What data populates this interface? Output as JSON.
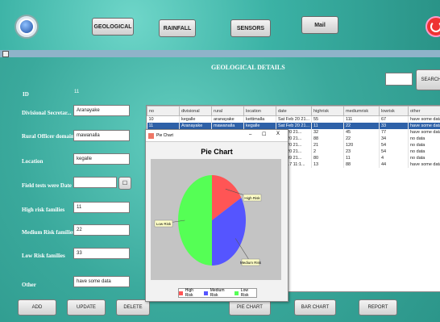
{
  "window": {
    "title": ""
  },
  "toolbar": {
    "geological": "GEOLOGICAL",
    "rainfall": "RAINFALL",
    "sensors": "SENSORS",
    "mail": "Mail"
  },
  "page": {
    "title": "GEOLOGICAL DETAILS"
  },
  "search": {
    "value": "",
    "button": "SEARCH"
  },
  "form": {
    "id_label": "ID",
    "id_value": "11",
    "divisional_label": "Divisional Secretar...",
    "divisional_value": "Aranayake",
    "rural_label": "Rural Officer domain",
    "rural_value": "mawanalla",
    "location_label": "Location",
    "location_value": "kegalle",
    "date_label": "Field tests were Date",
    "date_value": "",
    "high_label": "High risk families",
    "high_value": "11",
    "medium_label": "Medium Risk families",
    "medium_value": "22",
    "low_label": "Low Risk families",
    "low_value": "33",
    "other_label": "Other",
    "other_value": "have some data"
  },
  "table": {
    "columns": [
      "no",
      "divisional",
      "rural",
      "location",
      "date",
      "highrisk",
      "mediumrisk",
      "lowrisk",
      "other"
    ],
    "rows": [
      [
        "10",
        "kegalle",
        "aranayake",
        "kettimalla",
        "Sat Feb 20 21...",
        "55",
        "111",
        "67",
        "have some data"
      ],
      [
        "11",
        "Aranayake",
        "mawanalla",
        "kegalle",
        "Sat Feb 20 21...",
        "11",
        "22",
        "33",
        "have some data"
      ],
      [
        "",
        "",
        "",
        "",
        "Feb 20 21...",
        "32",
        "45",
        "77",
        "have some data"
      ],
      [
        "",
        "",
        "",
        "",
        "Feb 20 21...",
        "88",
        "22",
        "34",
        "no data"
      ],
      [
        "",
        "",
        "",
        "",
        "Feb 20 21...",
        "21",
        "120",
        "54",
        "no data"
      ],
      [
        "",
        "",
        "",
        "",
        "Feb 20 21...",
        "2",
        "23",
        "54",
        "no data"
      ],
      [
        "",
        "",
        "",
        "",
        "Feb 09 21...",
        "80",
        "11",
        "4",
        "no data"
      ],
      [
        "",
        "",
        "",
        "",
        "Feb 17 11:1...",
        "13",
        "88",
        "44",
        "have some data"
      ]
    ],
    "selected_row": 1
  },
  "buttons": {
    "add": "ADD",
    "update": "UPDATE",
    "delete": "DELETE",
    "pie_chart": "PIE CHART",
    "bar_chart": "BAR CHART",
    "report": "REPORT"
  },
  "dialog": {
    "title": "Pie Chart",
    "minimize": "–",
    "maximize": "☐",
    "close": "X"
  },
  "chart_data": {
    "type": "pie",
    "title": "Pie Chart",
    "categories": [
      "High Risk",
      "Medium Risk",
      "Low Risk"
    ],
    "values": [
      11,
      22,
      33
    ],
    "slice_labels": [
      "High Risk",
      "Medium Risk",
      "Low Risk"
    ],
    "legend": [
      "High Risk",
      "Medium Risk",
      "Low Risk"
    ],
    "colors": [
      "#ff5555",
      "#5555ff",
      "#55ff55"
    ],
    "legend_position": "bottom"
  },
  "colors": {
    "accent": "#3aa99d",
    "selected_row": "#2e61a8"
  },
  "icons": {
    "app": "app-logo-icon",
    "power": "power-icon",
    "calendar": "calendar-icon"
  }
}
